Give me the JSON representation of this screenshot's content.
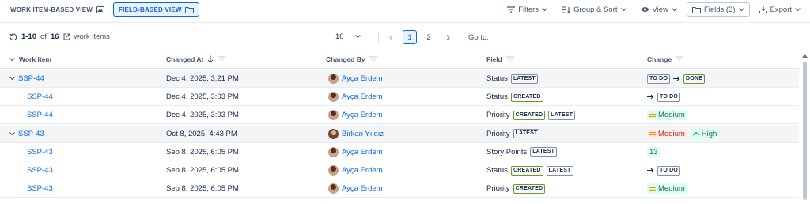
{
  "toolbar": {
    "views": [
      {
        "label": "WORK ITEM-BASED VIEW",
        "icon": "image-icon",
        "active": false
      },
      {
        "label": "FIELD-BASED VIEW",
        "icon": "folder-icon",
        "active": true
      }
    ],
    "filters_label": "Filters",
    "group_sort_label": "Group & Sort",
    "view_label": "View",
    "fields_label": "Fields (3)",
    "export_label": "Export"
  },
  "pagination": {
    "range": "1-10",
    "of_text": "of",
    "total": "16",
    "items_label": "work items",
    "per_page": "10",
    "pages": [
      "1",
      "2"
    ],
    "current_page": "1",
    "goto_label": "Go to:"
  },
  "table": {
    "headers": {
      "work_item": "Work Item",
      "changed_at": "Changed At",
      "changed_by": "Changed By",
      "field": "Field",
      "change": "Change"
    },
    "rows": [
      {
        "key": "SSP-44",
        "group": true,
        "changed_at": "Dec 4, 2025, 3:21 PM",
        "changed_by": "Ayça Erdem",
        "field": "Status",
        "tags": [
          "LATEST"
        ],
        "change": {
          "kind": "status",
          "from": "TO DO",
          "to": "DONE"
        }
      },
      {
        "key": "SSP-44",
        "group": false,
        "changed_at": "Dec 4, 2025, 3:03 PM",
        "changed_by": "Ayça Erdem",
        "field": "Status",
        "tags": [
          "CREATED"
        ],
        "change": {
          "kind": "status",
          "from": "",
          "to": "TO DO"
        }
      },
      {
        "key": "SSP-44",
        "group": false,
        "changed_at": "Dec 4, 2025, 3:03 PM",
        "changed_by": "Ayça Erdem",
        "field": "Priority",
        "tags": [
          "CREATED",
          "LATEST"
        ],
        "change": {
          "kind": "priority",
          "from": "",
          "to": "Medium"
        }
      },
      {
        "key": "SSP-43",
        "group": true,
        "changed_at": "Oct 8, 2025, 4:43 PM",
        "changed_by": "Birkan Yıldız",
        "field": "Priority",
        "tags": [
          "LATEST"
        ],
        "change": {
          "kind": "priority",
          "from": "Medium",
          "to": "High"
        }
      },
      {
        "key": "SSP-43",
        "group": false,
        "changed_at": "Sep 8, 2025, 6:05 PM",
        "changed_by": "Ayça Erdem",
        "field": "Story Points",
        "tags": [
          "LATEST"
        ],
        "change": {
          "kind": "number",
          "from": "",
          "to": "13"
        }
      },
      {
        "key": "SSP-43",
        "group": false,
        "changed_at": "Sep 8, 2025, 6:05 PM",
        "changed_by": "Ayça Erdem",
        "field": "Status",
        "tags": [
          "CREATED",
          "LATEST"
        ],
        "change": {
          "kind": "status",
          "from": "",
          "to": "TO DO"
        }
      },
      {
        "key": "SSP-43",
        "group": false,
        "changed_at": "Sep 8, 2025, 6:05 PM",
        "changed_by": "Ayça Erdem",
        "field": "Priority",
        "tags": [
          "CREATED"
        ],
        "change": {
          "kind": "priority",
          "from": "",
          "to": "Medium"
        }
      }
    ]
  },
  "colors": {
    "accent": "#0c66e4",
    "added": "#216e4e",
    "removed": "#ae2e24"
  }
}
